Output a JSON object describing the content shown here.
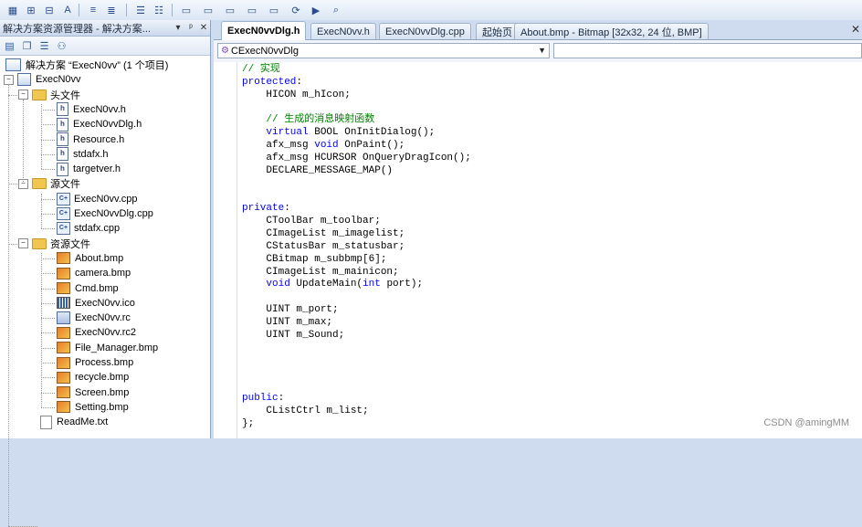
{
  "toolbar": {
    "buttons": [
      "class-view-icon",
      "toggle-bookmark-icon",
      "bookmark-icon",
      "font-icon",
      "indent-icon",
      "outdent-icon",
      "comment-icon",
      "uncomment-icon",
      "window-icon",
      "chat1-icon",
      "chat2-icon",
      "chat3-icon",
      "chat4-icon",
      "refresh-icon",
      "play-icon",
      "search-icon"
    ]
  },
  "solution_explorer": {
    "title": "解决方案资源管理器 - 解决方案...",
    "pin": "▾",
    "dock": "ᵖ",
    "close": "✕",
    "solution_label": "解决方案 “ExecN0vv” (1 个项目)",
    "project_label": "ExecN0vv",
    "folders": {
      "headers": "头文件",
      "sources": "源文件",
      "resources": "资源文件"
    },
    "header_files": [
      "ExecN0vv.h",
      "ExecN0vvDlg.h",
      "Resource.h",
      "stdafx.h",
      "targetver.h"
    ],
    "source_files": [
      "ExecN0vv.cpp",
      "ExecN0vvDlg.cpp",
      "stdafx.cpp"
    ],
    "resource_files": [
      {
        "name": "About.bmp",
        "kind": "bmp"
      },
      {
        "name": "camera.bmp",
        "kind": "bmp"
      },
      {
        "name": "Cmd.bmp",
        "kind": "bmp"
      },
      {
        "name": "ExecN0vv.ico",
        "kind": "ico"
      },
      {
        "name": "ExecN0vv.rc",
        "kind": "rc"
      },
      {
        "name": "ExecN0vv.rc2",
        "kind": "bmp"
      },
      {
        "name": "File_Manager.bmp",
        "kind": "bmp"
      },
      {
        "name": "Process.bmp",
        "kind": "bmp"
      },
      {
        "name": "recycle.bmp",
        "kind": "bmp"
      },
      {
        "name": "Screen.bmp",
        "kind": "bmp"
      },
      {
        "name": "Setting.bmp",
        "kind": "bmp"
      }
    ],
    "readme": "ReadMe.txt"
  },
  "tabs": [
    {
      "label": "ExecN0vvDlg.h",
      "active": true
    },
    {
      "label": "ExecN0vv.h",
      "active": false
    },
    {
      "label": "ExecN0vvDlg.cpp",
      "active": false
    },
    {
      "label": "起始页",
      "active": false
    },
    {
      "label": "About.bmp - Bitmap [32x32, 24 位, BMP]",
      "active": false
    }
  ],
  "tabs_close": "✕",
  "navbar": {
    "class_combo": "CExecN0vvDlg",
    "member_combo": ""
  },
  "code_lines": [
    [
      [
        "cm",
        "// 实现"
      ]
    ],
    [
      [
        "kw",
        "protected"
      ],
      [
        "",
        ":"
      ]
    ],
    [
      [
        "",
        "    HICON m_hIcon;"
      ]
    ],
    [],
    [
      [
        "",
        "    "
      ],
      [
        "cm",
        "// 生成的消息映射函数"
      ]
    ],
    [
      [
        "",
        "    "
      ],
      [
        "kw",
        "virtual"
      ],
      [
        "",
        " BOOL OnInitDialog();"
      ]
    ],
    [
      [
        "",
        "    afx_msg "
      ],
      [
        "kw",
        "void"
      ],
      [
        "",
        " OnPaint();"
      ]
    ],
    [
      [
        "",
        "    afx_msg HCURSOR OnQueryDragIcon();"
      ]
    ],
    [
      [
        "",
        "    DECLARE_MESSAGE_MAP()"
      ]
    ],
    [],
    [],
    [
      [
        "kw",
        "private"
      ],
      [
        "",
        ":"
      ]
    ],
    [
      [
        "",
        "    CToolBar m_toolbar;"
      ]
    ],
    [
      [
        "",
        "    CImageList m_imagelist;"
      ]
    ],
    [
      [
        "",
        "    CStatusBar m_statusbar;"
      ]
    ],
    [
      [
        "",
        "    CBitmap m_subbmp[6];"
      ]
    ],
    [
      [
        "",
        "    CImageList m_mainicon;"
      ]
    ],
    [
      [
        "",
        "    "
      ],
      [
        "kw",
        "void"
      ],
      [
        "",
        " UpdateMain("
      ],
      [
        "kw",
        "int"
      ],
      [
        "",
        " port);"
      ]
    ],
    [],
    [
      [
        "",
        "    UINT m_port;"
      ]
    ],
    [
      [
        "",
        "    UINT m_max;"
      ]
    ],
    [
      [
        "",
        "    UINT m_Sound;"
      ]
    ],
    [],
    [],
    [],
    [],
    [
      [
        "kw",
        "public"
      ],
      [
        "",
        ":"
      ]
    ],
    [
      [
        "",
        "    CListCtrl m_list;"
      ]
    ],
    [
      [
        "",
        "};"
      ]
    ]
  ],
  "watermark": "CSDN @amingMM"
}
